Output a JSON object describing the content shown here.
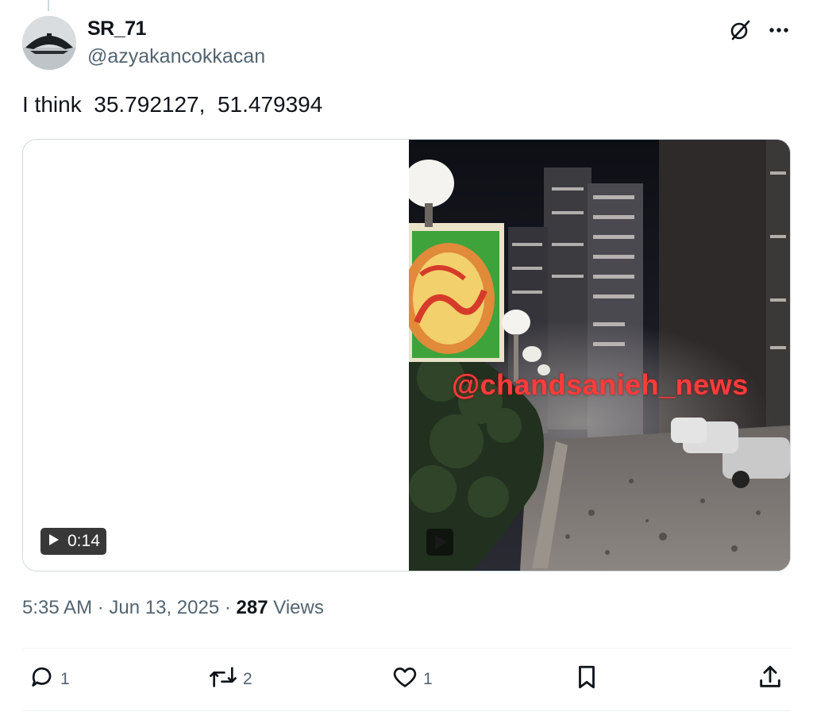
{
  "author": {
    "display_name": "SR_71",
    "handle": "@azyakancokkacan"
  },
  "tweet": {
    "text": "I think  35.792127,  51.479394"
  },
  "media": {
    "duration": "0:14",
    "watermark": "@chandsanieh_news"
  },
  "meta": {
    "time": "5:35 AM",
    "separator": "·",
    "date": "Jun 13, 2025",
    "views_count": "287",
    "views_label": "Views"
  },
  "actions": {
    "replies": "1",
    "reposts": "2",
    "likes": "1"
  },
  "icons": {
    "grok": "grok-icon",
    "more": "more-icon",
    "reply": "reply-icon",
    "repost": "repost-icon",
    "like": "like-icon",
    "bookmark": "bookmark-icon",
    "share": "share-icon",
    "play": "play-icon"
  },
  "colors": {
    "text_primary": "#0f1419",
    "text_secondary": "#536471",
    "border": "#cfd9de",
    "watermark": "#ff3b3b"
  }
}
